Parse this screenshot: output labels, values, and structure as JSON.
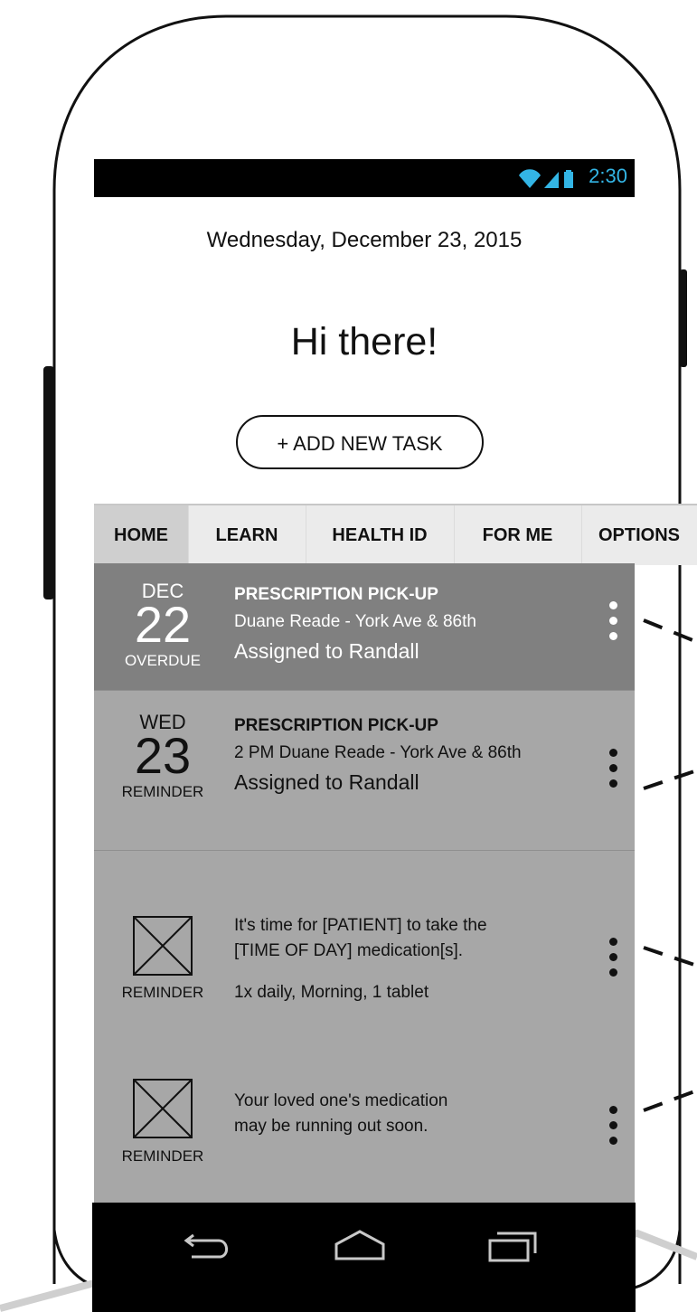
{
  "status_bar": {
    "time": "2:30",
    "icons": [
      "wifi-icon",
      "signal-icon",
      "battery-icon"
    ],
    "time_color": "#33b5e5"
  },
  "header": {
    "date": "Wednesday, December 23, 2015",
    "greeting": "Hi there!",
    "add_task_label": "+ ADD NEW TASK"
  },
  "tabs": [
    {
      "label": "HOME",
      "active": true
    },
    {
      "label": "LEARN",
      "active": false
    },
    {
      "label": "HEALTH ID",
      "active": false
    },
    {
      "label": "FOR ME",
      "active": false
    },
    {
      "label": "OPTIONS",
      "active": false
    }
  ],
  "cards": [
    {
      "month": "DEC",
      "day": "22",
      "tag": "OVERDUE",
      "title": "PRESCRIPTION PICK-UP",
      "detail": "Duane Reade - York Ave & 86th",
      "assignee": "Assigned to Randall"
    },
    {
      "month": "WED",
      "day": "23",
      "tag": "REMINDER",
      "title": "PRESCRIPTION PICK-UP",
      "detail": "2 PM Duane Reade - York Ave & 86th",
      "assignee": "Assigned to Randall"
    },
    {
      "tag": "REMINDER",
      "line1": "It's time for [PATIENT] to take the",
      "line2": "[TIME OF DAY] medication[s].",
      "schedule": "1x daily, Morning, 1 tablet"
    },
    {
      "tag": "REMINDER",
      "line1": "Your loved one's medication",
      "line2": "may be running out soon."
    }
  ],
  "nav_bar": {
    "icons": [
      "back-icon",
      "home-icon",
      "recents-icon"
    ]
  },
  "colors": {
    "overdue_card": "#808080",
    "reminder_card": "#a7a7a7",
    "active_tab": "#cfcfcf"
  }
}
